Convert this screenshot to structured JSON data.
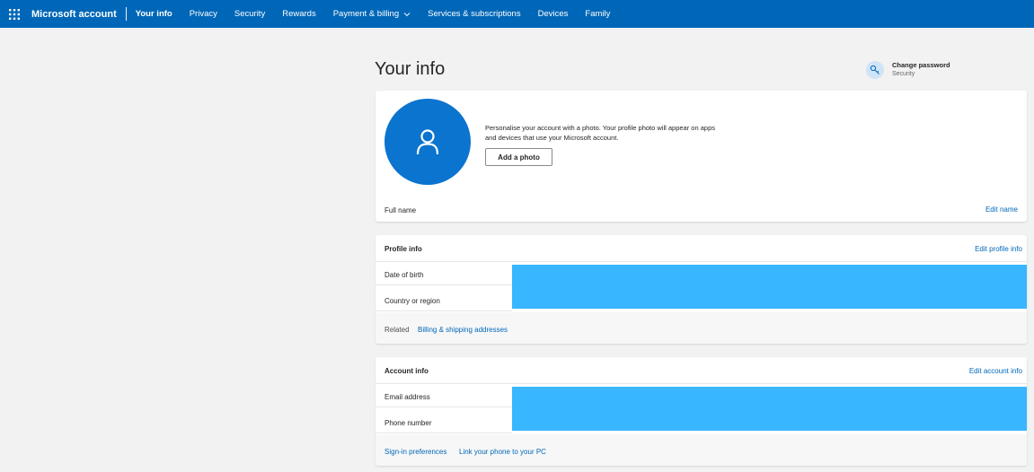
{
  "nav": {
    "brand": "Microsoft account",
    "items": [
      {
        "label": "Your info",
        "active": true
      },
      {
        "label": "Privacy"
      },
      {
        "label": "Security"
      },
      {
        "label": "Rewards"
      },
      {
        "label": "Payment & billing",
        "dropdown": true
      },
      {
        "label": "Services & subscriptions"
      },
      {
        "label": "Devices"
      },
      {
        "label": "Family"
      }
    ]
  },
  "page": {
    "title": "Your info",
    "change_password": {
      "label": "Change password",
      "sublabel": "Security",
      "icon": "key-icon"
    }
  },
  "photo_card": {
    "description": "Personalise your account with a photo. Your profile photo will appear on apps and devices that use your Microsoft account.",
    "add_photo": "Add a photo",
    "full_name_label": "Full name",
    "edit_name": "Edit name"
  },
  "profile_info": {
    "title": "Profile info",
    "edit": "Edit profile info",
    "rows": [
      "Date of birth",
      "Country or region"
    ],
    "related_label": "Related",
    "related_link": "Billing & shipping addresses"
  },
  "account_info": {
    "title": "Account info",
    "edit": "Edit account info",
    "rows": [
      "Email address",
      "Phone number"
    ],
    "links": [
      "Sign-in preferences",
      "Link your phone to your PC"
    ]
  },
  "colors": {
    "nav_bg": "#0067b8",
    "accent": "#0067b8",
    "avatar": "#0a74cf",
    "redaction": "#38b6ff"
  }
}
